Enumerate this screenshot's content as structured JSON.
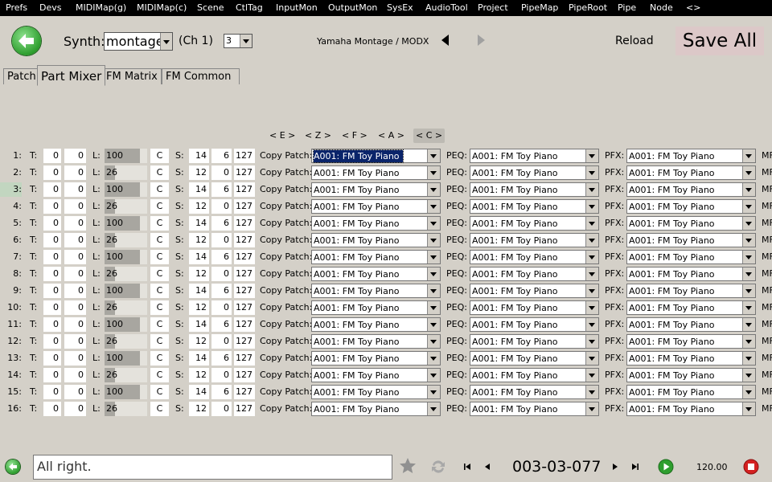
{
  "menu": [
    "Prefs",
    "Devs",
    "MIDIMap(g)",
    "MIDIMap(c)",
    "Scene",
    "CtlTag",
    "InputMon",
    "OutputMon",
    "SysEx",
    "AudioTool",
    "Project",
    "PipeMap",
    "PipeRoot",
    "Pipe",
    "Node",
    "<>"
  ],
  "header": {
    "synth_label": "Synth:",
    "synth_value": "montage",
    "channel": "(Ch 1)",
    "channel_select": "3",
    "synth_name": "Yamaha Montage / MODX",
    "reload": "Reload",
    "save_all": "Save All"
  },
  "tabs": [
    "Patch",
    "Part Mixer",
    "FM Matrix",
    "FM Common"
  ],
  "active_tab": "Part Mixer",
  "scale_buttons": [
    "< E >",
    "< Z >",
    "< F >",
    "< A >",
    "< C >"
  ],
  "selected_scale": "< C >",
  "labels": {
    "t": "T:",
    "l": "L:",
    "s": "S:",
    "copy": "Copy Patch:",
    "peq": "PEQ:",
    "pfx": "PFX:",
    "mf": "MF"
  },
  "parts": [
    {
      "num": "1:",
      "t1": "0",
      "t2": "0",
      "level": "100",
      "pan": "C",
      "s1": "14",
      "s2": "6",
      "s3": "127",
      "copy": "A001: FM Toy Piano",
      "peq": "A001: FM Toy Piano",
      "pfx": "A001: FM Toy Piano"
    },
    {
      "num": "2:",
      "t1": "0",
      "t2": "0",
      "level": "26",
      "pan": "C",
      "s1": "12",
      "s2": "0",
      "s3": "127",
      "copy": "A001: FM Toy Piano",
      "peq": "A001: FM Toy Piano",
      "pfx": "A001: FM Toy Piano"
    },
    {
      "num": "3:",
      "t1": "0",
      "t2": "0",
      "level": "100",
      "pan": "C",
      "s1": "14",
      "s2": "6",
      "s3": "127",
      "copy": "A001: FM Toy Piano",
      "peq": "A001: FM Toy Piano",
      "pfx": "A001: FM Toy Piano"
    },
    {
      "num": "4:",
      "t1": "0",
      "t2": "0",
      "level": "26",
      "pan": "C",
      "s1": "12",
      "s2": "0",
      "s3": "127",
      "copy": "A001: FM Toy Piano",
      "peq": "A001: FM Toy Piano",
      "pfx": "A001: FM Toy Piano"
    },
    {
      "num": "5:",
      "t1": "0",
      "t2": "0",
      "level": "100",
      "pan": "C",
      "s1": "14",
      "s2": "6",
      "s3": "127",
      "copy": "A001: FM Toy Piano",
      "peq": "A001: FM Toy Piano",
      "pfx": "A001: FM Toy Piano"
    },
    {
      "num": "6:",
      "t1": "0",
      "t2": "0",
      "level": "26",
      "pan": "C",
      "s1": "12",
      "s2": "0",
      "s3": "127",
      "copy": "A001: FM Toy Piano",
      "peq": "A001: FM Toy Piano",
      "pfx": "A001: FM Toy Piano"
    },
    {
      "num": "7:",
      "t1": "0",
      "t2": "0",
      "level": "100",
      "pan": "C",
      "s1": "14",
      "s2": "6",
      "s3": "127",
      "copy": "A001: FM Toy Piano",
      "peq": "A001: FM Toy Piano",
      "pfx": "A001: FM Toy Piano"
    },
    {
      "num": "8:",
      "t1": "0",
      "t2": "0",
      "level": "26",
      "pan": "C",
      "s1": "12",
      "s2": "0",
      "s3": "127",
      "copy": "A001: FM Toy Piano",
      "peq": "A001: FM Toy Piano",
      "pfx": "A001: FM Toy Piano"
    },
    {
      "num": "9:",
      "t1": "0",
      "t2": "0",
      "level": "100",
      "pan": "C",
      "s1": "14",
      "s2": "6",
      "s3": "127",
      "copy": "A001: FM Toy Piano",
      "peq": "A001: FM Toy Piano",
      "pfx": "A001: FM Toy Piano"
    },
    {
      "num": "10:",
      "t1": "0",
      "t2": "0",
      "level": "26",
      "pan": "C",
      "s1": "12",
      "s2": "0",
      "s3": "127",
      "copy": "A001: FM Toy Piano",
      "peq": "A001: FM Toy Piano",
      "pfx": "A001: FM Toy Piano"
    },
    {
      "num": "11:",
      "t1": "0",
      "t2": "0",
      "level": "100",
      "pan": "C",
      "s1": "14",
      "s2": "6",
      "s3": "127",
      "copy": "A001: FM Toy Piano",
      "peq": "A001: FM Toy Piano",
      "pfx": "A001: FM Toy Piano"
    },
    {
      "num": "12:",
      "t1": "0",
      "t2": "0",
      "level": "26",
      "pan": "C",
      "s1": "12",
      "s2": "0",
      "s3": "127",
      "copy": "A001: FM Toy Piano",
      "peq": "A001: FM Toy Piano",
      "pfx": "A001: FM Toy Piano"
    },
    {
      "num": "13:",
      "t1": "0",
      "t2": "0",
      "level": "100",
      "pan": "C",
      "s1": "14",
      "s2": "6",
      "s3": "127",
      "copy": "A001: FM Toy Piano",
      "peq": "A001: FM Toy Piano",
      "pfx": "A001: FM Toy Piano"
    },
    {
      "num": "14:",
      "t1": "0",
      "t2": "0",
      "level": "26",
      "pan": "C",
      "s1": "12",
      "s2": "0",
      "s3": "127",
      "copy": "A001: FM Toy Piano",
      "peq": "A001: FM Toy Piano",
      "pfx": "A001: FM Toy Piano"
    },
    {
      "num": "15:",
      "t1": "0",
      "t2": "0",
      "level": "100",
      "pan": "C",
      "s1": "14",
      "s2": "6",
      "s3": "127",
      "copy": "A001: FM Toy Piano",
      "peq": "A001: FM Toy Piano",
      "pfx": "A001: FM Toy Piano"
    },
    {
      "num": "16:",
      "t1": "0",
      "t2": "0",
      "level": "26",
      "pan": "C",
      "s1": "12",
      "s2": "0",
      "s3": "127",
      "copy": "A001: FM Toy Piano",
      "peq": "A001: FM Toy Piano",
      "pfx": "A001: FM Toy Piano"
    }
  ],
  "highlighted_part": "3:",
  "focused_copy_part": "1:",
  "status": {
    "message": "All right.",
    "counter": "003-03-077",
    "tempo": "120.00"
  },
  "icons": {
    "back": "back-arrow-icon",
    "star": "star-icon",
    "sync": "sync-icon",
    "first": "skip-first-icon",
    "prev": "prev-icon",
    "next": "next-icon",
    "last": "skip-last-icon",
    "play": "play-icon",
    "stop": "stop-icon"
  },
  "colors": {
    "menu_bg": "#000000",
    "save_bg": "#dcc8c8",
    "selection": "#0a246a",
    "play": "#2e9e2e",
    "stop": "#d42020"
  }
}
